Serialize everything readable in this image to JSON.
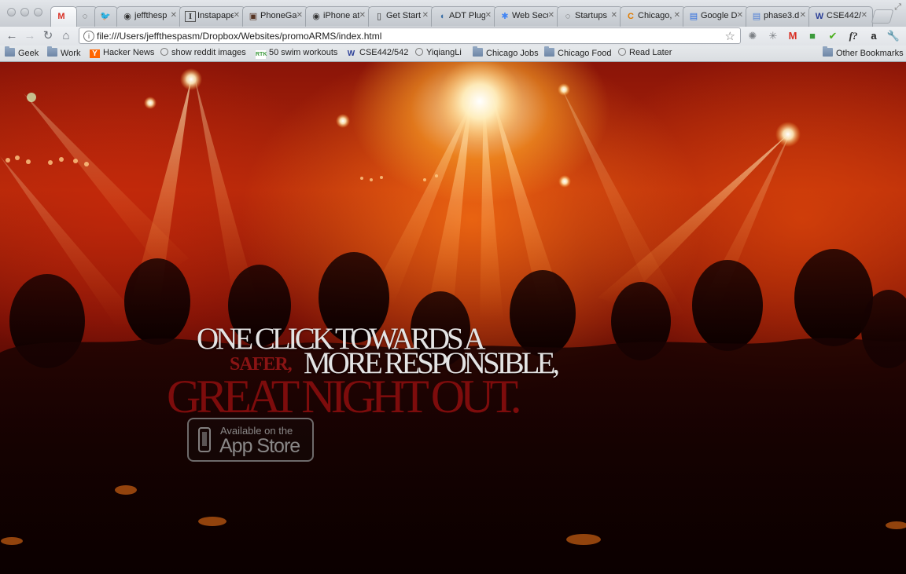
{
  "tabs": [
    {
      "icon": "gmail-icon",
      "glyph": "M",
      "label": "",
      "active": true
    },
    {
      "icon": "globe-icon",
      "glyph": "◌",
      "label": ""
    },
    {
      "icon": "twitter-icon",
      "glyph": "🐦",
      "label": ""
    },
    {
      "icon": "github-icon",
      "glyph": "◉",
      "label": "jeffthesp"
    },
    {
      "icon": "instapaper-icon",
      "glyph": "I",
      "label": "Instapape"
    },
    {
      "icon": "phonegap-icon",
      "glyph": "▣",
      "label": "PhoneGa"
    },
    {
      "icon": "github-icon",
      "glyph": "◉",
      "label": "iPhone at"
    },
    {
      "icon": "phone-icon",
      "glyph": "▯",
      "label": "Get Start"
    },
    {
      "icon": "adt-icon",
      "glyph": "◖",
      "label": "ADT Plug"
    },
    {
      "icon": "google-icon",
      "glyph": "✱",
      "label": "Web Secu"
    },
    {
      "icon": "globe-icon",
      "glyph": "◌",
      "label": "Startups"
    },
    {
      "icon": "chicago-icon",
      "glyph": "C",
      "label": "Chicago,"
    },
    {
      "icon": "google-docs-icon",
      "glyph": "▤",
      "label": "Google D"
    },
    {
      "icon": "doc-icon",
      "glyph": "▤",
      "label": "phase3.d"
    },
    {
      "icon": "uw-icon",
      "glyph": "W",
      "label": "CSE442/5"
    }
  ],
  "toolbar": {
    "url": "file:///Users/jeffthespasm/Dropbox/Websites/promoARMS/index.html",
    "extensions": [
      "settings-icon",
      "sparkle-icon",
      "gmail-icon",
      "badge-icon",
      "check-icon",
      "fquery-icon",
      "amazon-icon",
      "wrench-icon"
    ]
  },
  "bookmarks": {
    "items": [
      {
        "label": "Geek",
        "type": "folder"
      },
      {
        "label": "Work",
        "type": "folder"
      },
      {
        "label": "Hacker News",
        "type": "yc"
      },
      {
        "label": "show reddit images",
        "type": "globe"
      },
      {
        "label": "50 swim workouts",
        "type": "rtk"
      },
      {
        "label": "CSE442/542",
        "type": "uw"
      },
      {
        "label": "YiqiangLi",
        "type": "globe"
      },
      {
        "label": "Chicago Jobs",
        "type": "folder"
      },
      {
        "label": "Chicago Food",
        "type": "folder"
      },
      {
        "label": "Read Later",
        "type": "globe"
      }
    ],
    "other": "Other Bookmarks"
  },
  "page": {
    "line1": "ONE CLICK TOWARDS A",
    "safer": "SAFER,",
    "line2": "MORE RESPONSIBLE,",
    "line3": "GREAT NIGHT OUT.",
    "appstore_small": "Available on the",
    "appstore_big": "App Store"
  },
  "colors": {
    "headline_light": "#e4e4e4",
    "headline_red": "#7d0c0c",
    "accent_orange": "#ff8a1a"
  }
}
